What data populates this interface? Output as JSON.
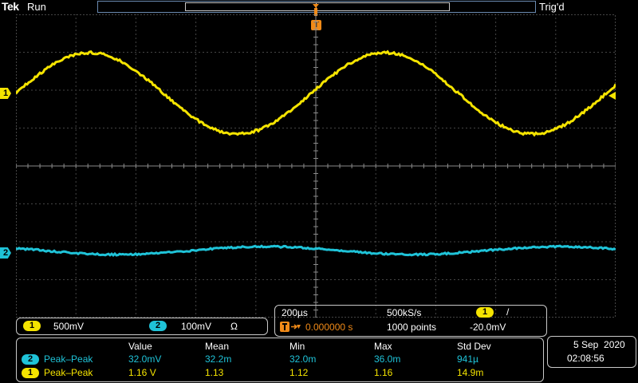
{
  "header": {
    "brand": "Tek",
    "run_state": "Run",
    "trigger_state": "Trig'd"
  },
  "markers": {
    "ch1": "1",
    "ch2": "2",
    "trigger": "T"
  },
  "channels": {
    "ch1": {
      "number": "1",
      "scale": "500mV",
      "color": "#f5e400"
    },
    "ch2": {
      "number": "2",
      "scale": "100mV",
      "coupling_symbol": "Ω",
      "color": "#1fc3d8"
    }
  },
  "timebase": {
    "horizontal_scale": "200µs",
    "sample_rate": "500kS/s",
    "trigger_source": "1",
    "trigger_slope": "/",
    "trigger_position": "0.000000 s",
    "record_length": "1000 points",
    "trigger_level": "-20.0mV"
  },
  "measurements": {
    "headers": [
      "Value",
      "Mean",
      "Min",
      "Max",
      "Std Dev"
    ],
    "rows": [
      {
        "channel": "2",
        "label": "Peak–Peak",
        "value": "32.0mV",
        "mean": "32.2m",
        "min": "32.0m",
        "max": "36.0m",
        "std_dev": "941µ"
      },
      {
        "channel": "1",
        "label": "Peak–Peak",
        "value": "1.16 V",
        "mean": "1.13",
        "min": "1.12",
        "max": "1.16",
        "std_dev": "14.9m"
      }
    ]
  },
  "datetime": {
    "date": "5 Sep  2020",
    "time": "02:08:56"
  },
  "colors": {
    "ch1": "#f5e400",
    "ch2": "#1fc3d8",
    "trigger": "#f08a18",
    "grid": "#8a8a8a"
  }
}
